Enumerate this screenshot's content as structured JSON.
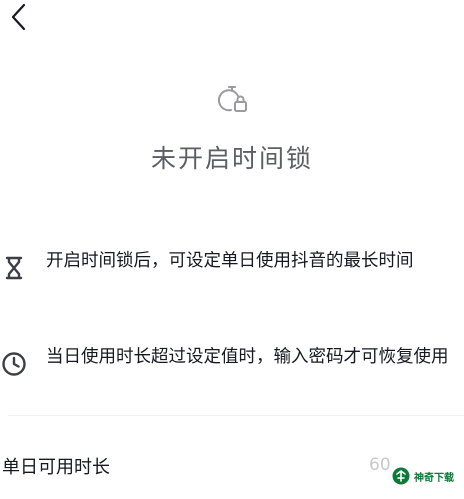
{
  "header": {
    "back_icon": "chevron-left-icon"
  },
  "status": {
    "icon": "timer-lock-icon",
    "title": "未开启时间锁"
  },
  "features": [
    {
      "icon": "hourglass-icon",
      "text": "开启时间锁后，可设定单日使用抖音的最长时间"
    },
    {
      "icon": "clock-icon",
      "text": "当日使用时长超过设定值时，输入密码才可恢复使用"
    }
  ],
  "daily_limit": {
    "label": "单日可用时长",
    "value": "60"
  },
  "watermark": {
    "logo": "shenqi-logo",
    "text": "神奇下载"
  },
  "colors": {
    "primary_text": "#161823",
    "secondary_text": "#5c5e66",
    "muted_value": "#c8c9cc",
    "watermark_green": "#0c7a39"
  }
}
